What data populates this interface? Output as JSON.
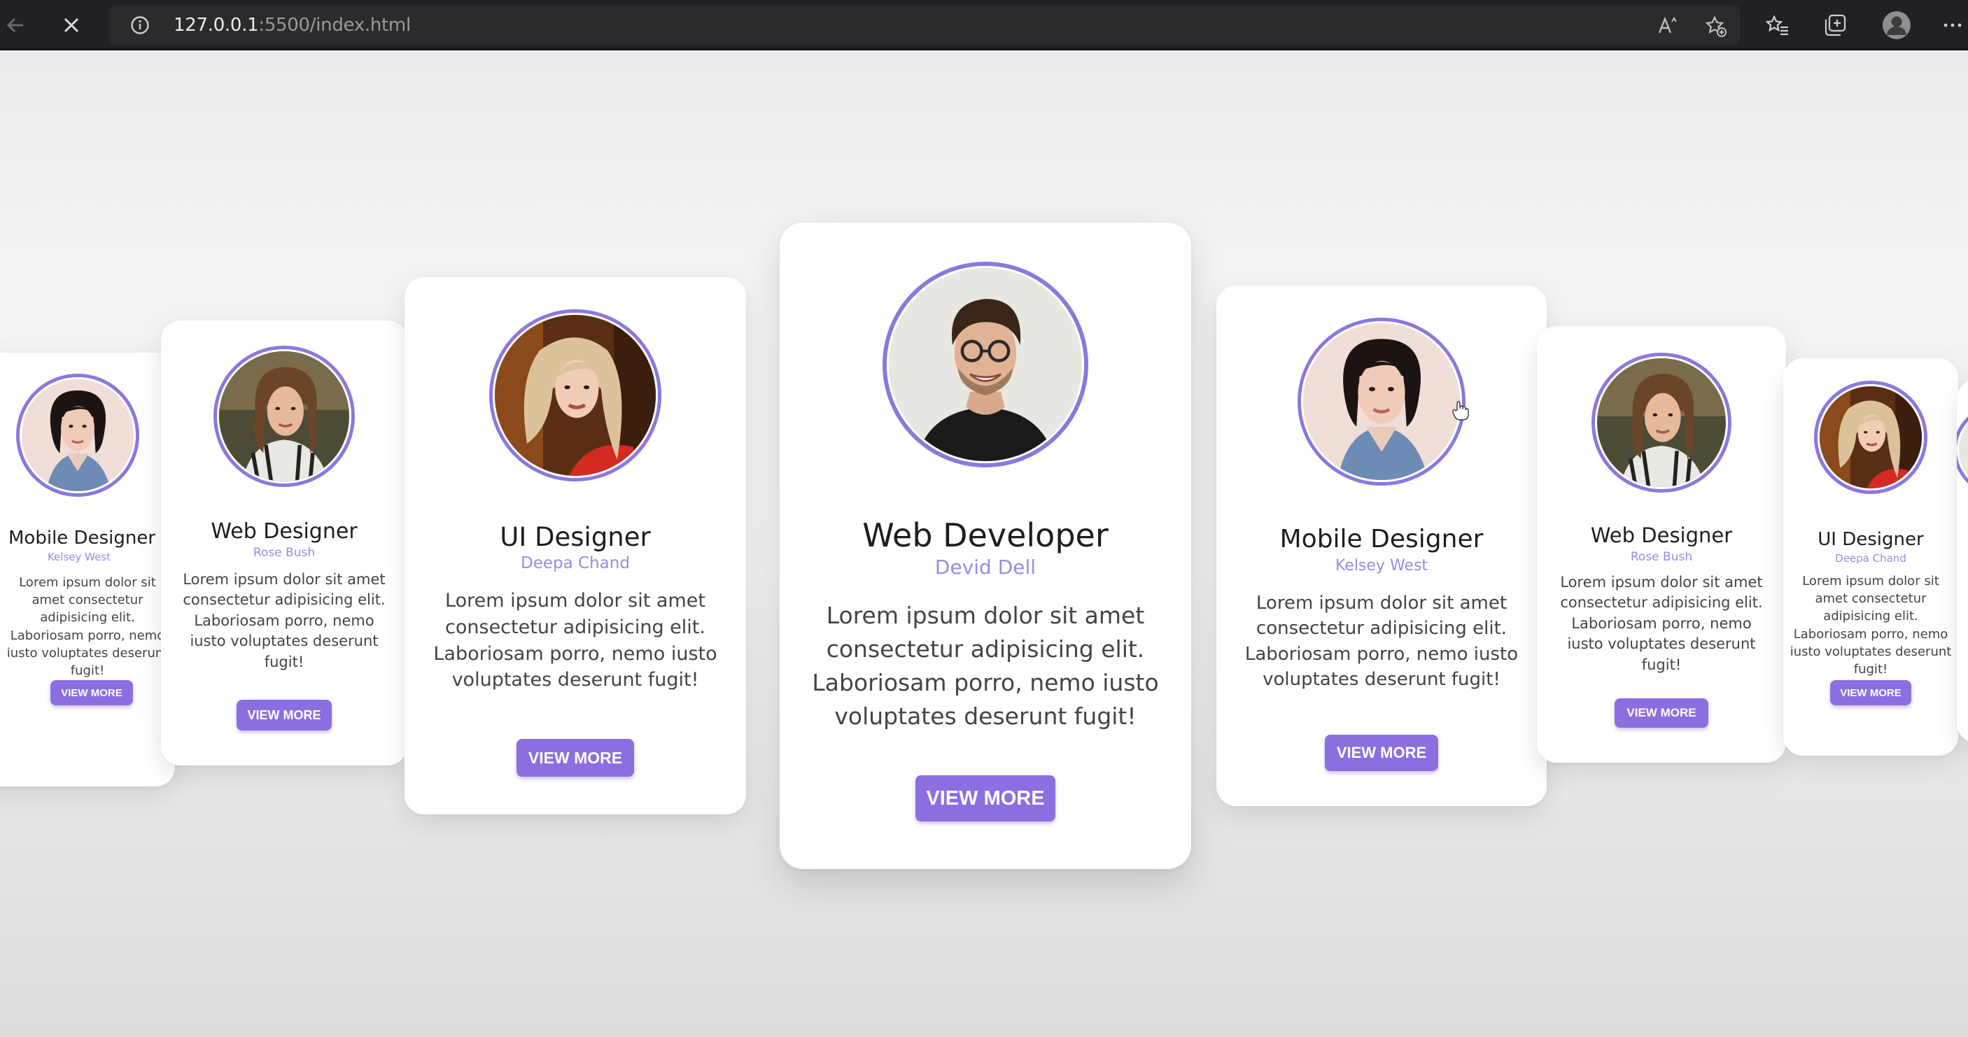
{
  "browser": {
    "url_host": "127.0.0.1",
    "url_path": ":5500/index.html",
    "icons": [
      "back-icon",
      "close-icon",
      "info-icon",
      "read-aloud-icon",
      "favorite-add-icon",
      "favorites-icon",
      "collections-icon",
      "profile-icon",
      "more-icon"
    ]
  },
  "colors": {
    "accent": "#8b6fe0",
    "ring": "#8b78dc",
    "name": "#9b8ae6"
  },
  "cards": [
    {
      "title": "Mobile Designer",
      "name": "Kelsey West",
      "desc": "Lorem ipsum dolor sit amet consectetur adipisicing elit. Laboriosam porro, nemo iusto voluptates deserunt fugit!",
      "button": "VIEW MORE"
    },
    {
      "title": "Web Designer",
      "name": "Rose Bush",
      "desc": "Lorem ipsum dolor sit amet consectetur adipisicing elit. Laboriosam porro, nemo iusto voluptates deserunt fugit!",
      "button": "VIEW MORE"
    },
    {
      "title": "UI Designer",
      "name": "Deepa Chand",
      "desc": "Lorem ipsum dolor sit amet consectetur adipisicing elit. Laboriosam porro, nemo iusto voluptates deserunt fugit!",
      "button": "VIEW MORE"
    },
    {
      "title": "Web Developer",
      "name": "Devid Dell",
      "desc": "Lorem ipsum dolor sit amet consectetur adipisicing elit. Laboriosam porro, nemo iusto voluptates deserunt fugit!",
      "button": "VIEW MORE"
    },
    {
      "title": "Mobile Designer",
      "name": "Kelsey West",
      "desc": "Lorem ipsum dolor sit amet consectetur adipisicing elit. Laboriosam porro, nemo iusto voluptates deserunt fugit!",
      "button": "VIEW MORE"
    },
    {
      "title": "Web Designer",
      "name": "Rose Bush",
      "desc": "Lorem ipsum dolor sit amet consectetur adipisicing elit. Laboriosam porro, nemo iusto voluptates deserunt fugit!",
      "button": "VIEW MORE"
    },
    {
      "title": "UI Designer",
      "name": "Deepa Chand",
      "desc": "Lorem ipsum dolor sit amet consectetur adipisicing elit. Laboriosam porro, nemo iusto voluptates deserunt fugit!",
      "button": "VIEW MORE"
    }
  ]
}
